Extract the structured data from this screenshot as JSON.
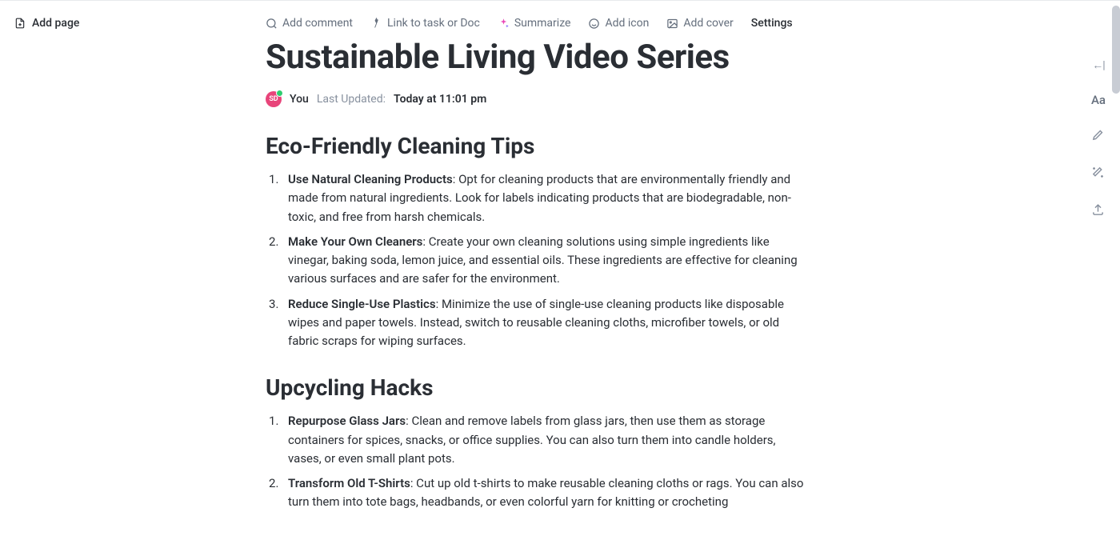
{
  "sidebar": {
    "add_page": "Add page"
  },
  "toolbar": {
    "add_comment": "Add comment",
    "link_task": "Link to task or Doc",
    "summarize": "Summarize",
    "add_icon": "Add icon",
    "add_cover": "Add cover",
    "settings": "Settings"
  },
  "page": {
    "title": "Sustainable Living Video Series",
    "avatar_initials": "SD",
    "author": "You",
    "updated_label": "Last Updated:",
    "updated_time": "Today at 11:01 pm"
  },
  "sections": [
    {
      "heading": "Eco-Friendly Cleaning Tips",
      "items": [
        {
          "bold": "Use Natural Cleaning Products",
          "text": ": Opt for cleaning products that are environmentally friendly and made from natural ingredients. Look for labels indicating products that are biodegradable, non-toxic, and free from harsh chemicals."
        },
        {
          "bold": "Make Your Own Cleaners",
          "text": ": Create your own cleaning solutions using simple ingredients like vinegar, baking soda, lemon juice, and essential oils. These ingredients are effective for cleaning various surfaces and are safer for the environment."
        },
        {
          "bold": "Reduce Single-Use Plastics",
          "text": ": Minimize the use of single-use cleaning products like disposable wipes and paper towels. Instead, switch to reusable cleaning cloths, microfiber towels, or old fabric scraps for wiping surfaces."
        }
      ]
    },
    {
      "heading": "Upcycling Hacks",
      "items": [
        {
          "bold": "Repurpose Glass Jars",
          "text": ": Clean and remove labels from glass jars, then use them as storage containers for spices, snacks, or office supplies. You can also turn them into candle holders, vases, or even small plant pots."
        },
        {
          "bold": "Transform Old T-Shirts",
          "text": ": Cut up old t-shirts to make reusable cleaning cloths or rags. You can also turn them into tote bags, headbands, or even colorful yarn for knitting or crocheting"
        }
      ]
    }
  ],
  "right_tools": {
    "collapse": "←|",
    "typography": "Aa"
  }
}
